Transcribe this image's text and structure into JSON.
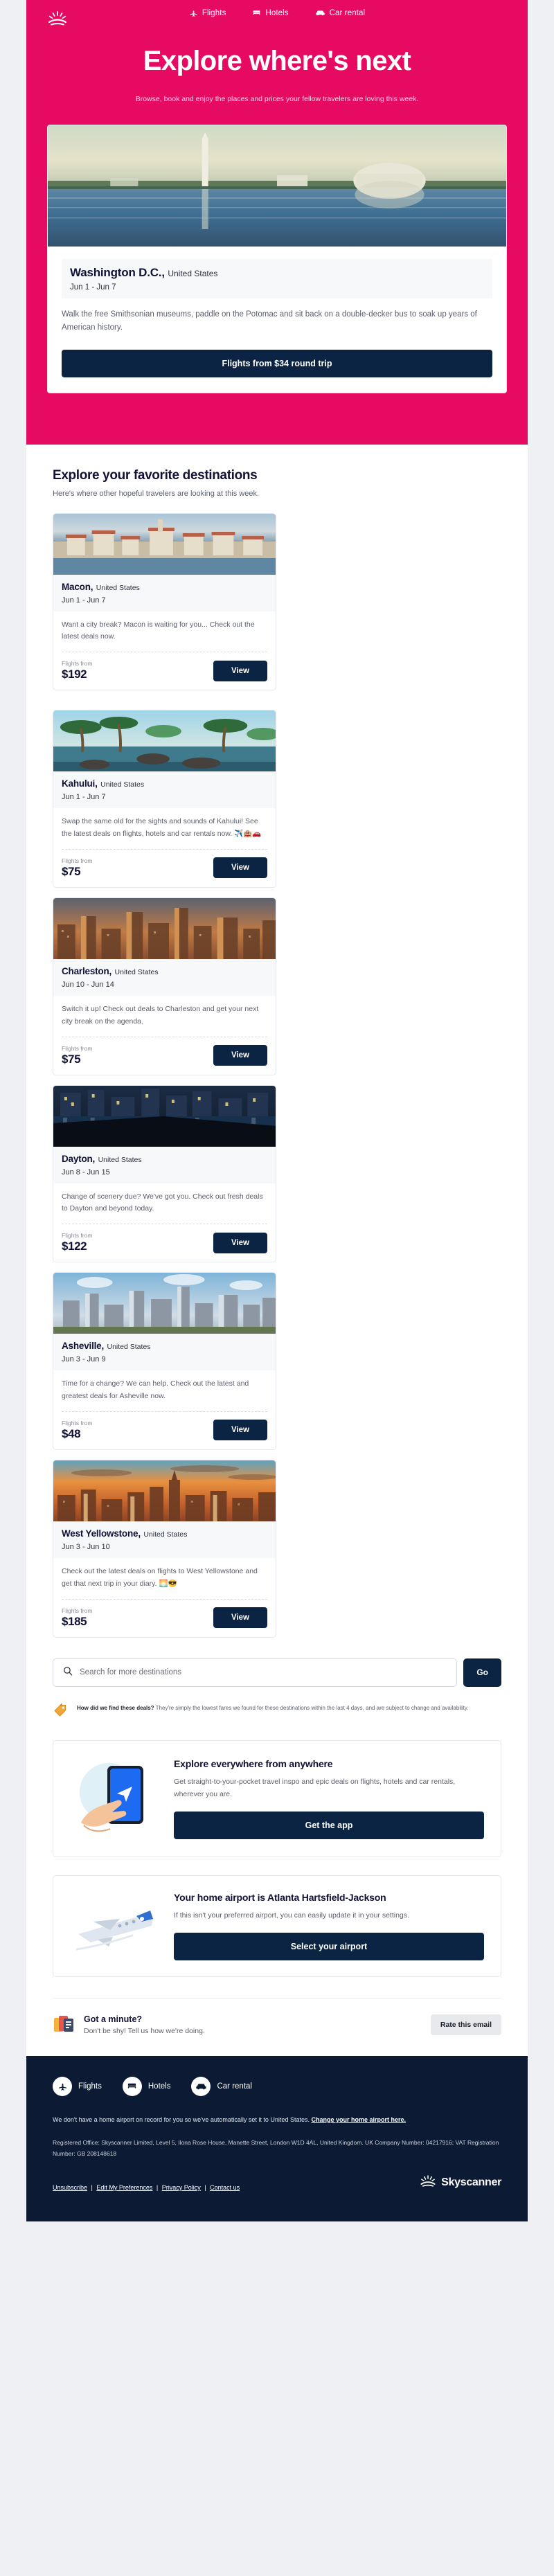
{
  "brand": {
    "name": "Skyscanner",
    "pink": "#e70a62",
    "navy": "#0c2444",
    "footer_navy": "#0c1b33"
  },
  "nav": {
    "logo": "sunrise-logo",
    "links": [
      {
        "label": "Flights",
        "icon": "plane-icon"
      },
      {
        "label": "Hotels",
        "icon": "bed-icon"
      },
      {
        "label": "Car rental",
        "icon": "car-icon"
      }
    ]
  },
  "hero": {
    "title": "Explore where's next",
    "subtitle": "Browse, book and enjoy the places and prices your fellow travelers are loving this week."
  },
  "feature": {
    "photo": "washington-dc-tidal-basin-photo",
    "name": "Washington D.C.,",
    "country": "United States",
    "dates": "Jun 1 - Jun 7",
    "description": "Walk the free Smithsonian museums, paddle on the Potomac and sit back on a double-decker bus to soak up years of American history.",
    "cta": "Flights from $34 round trip"
  },
  "section": {
    "title": "Explore your favorite destinations",
    "subtitle": "Here's where other hopeful travelers are looking at this week."
  },
  "destinations": [
    {
      "photo": "macon-coastal-town-photo",
      "name": "Macon,",
      "country": "United States",
      "dates": "Jun 1 - Jun 7",
      "description": "Want a city break? Macon is waiting for you... Check out the latest deals now.",
      "price_label": "Flights from",
      "price": "$192",
      "cta": "View"
    },
    {
      "photo": "kahului-palm-beach-photo",
      "name": "Kahului,",
      "country": "United States",
      "dates": "Jun 1 - Jun 7",
      "description": "Swap the same old for the sights and sounds of Kahului! See the latest deals on flights, hotels and car rentals now. ✈️🏨🚗",
      "price_label": "Flights from",
      "price": "$75",
      "cta": "View"
    },
    {
      "photo": "charleston-sunset-skyline-photo",
      "name": "Charleston,",
      "country": "United States",
      "dates": "Jun 10 - Jun 14",
      "description": "Switch it up! Check out deals to Charleston and get your next city break on the agenda.",
      "price_label": "Flights from",
      "price": "$75",
      "cta": "View"
    },
    {
      "photo": "dayton-night-waterfront-photo",
      "name": "Dayton,",
      "country": "United States",
      "dates": "Jun 8 - Jun 15",
      "description": "Change of scenery due? We've got you. Check out fresh deals to Dayton and beyond today.",
      "price_label": "Flights from",
      "price": "$122",
      "cta": "View"
    },
    {
      "photo": "asheville-city-skyline-photo",
      "name": "Asheville,",
      "country": "United States",
      "dates": "Jun 3 - Jun 9",
      "description": "Time for a change? We can help. Check out the latest and greatest deals for Asheville now.",
      "price_label": "Flights from",
      "price": "$48",
      "cta": "View"
    },
    {
      "photo": "west-yellowstone-sunset-skyline-photo",
      "name": "West Yellowstone,",
      "country": "United States",
      "dates": "Jun 3 - Jun 10",
      "description": "Check out the latest deals on flights to West Yellowstone and get that next trip in your diary. 🌅😎",
      "price_label": "Flights from",
      "price": "$185",
      "cta": "View"
    }
  ],
  "search": {
    "placeholder": "Search for more destinations",
    "value": "",
    "button": "Go",
    "icon": "search-icon"
  },
  "disclaimer": {
    "icon": "price-tag-icon",
    "lead": "How did we find these deals?",
    "text": " They're simply the lowest fares we found for these destinations within the last 4 days, and are subject to change and availability."
  },
  "promos": [
    {
      "art": "hand-holding-phone-illustration",
      "title": "Explore everywhere from anywhere",
      "description": "Get straight-to-your-pocket travel inspo and epic deals on flights, hotels and car rentals, wherever you are.",
      "cta": "Get the app"
    },
    {
      "art": "airplane-illustration",
      "title": "Your home airport is Atlanta Hartsfield-Jackson",
      "description": "If this isn't your preferred airport, you can easily update it in your settings.",
      "cta": "Select your airport"
    }
  ],
  "feedback": {
    "icon": "feedback-cards-icon",
    "title": "Got a minute?",
    "subtitle": "Don't be shy! Tell us how we're doing.",
    "button": "Rate this email"
  },
  "footer": {
    "links": [
      {
        "label": "Flights",
        "icon": "plane-icon"
      },
      {
        "label": "Hotels",
        "icon": "bed-icon"
      },
      {
        "label": "Car rental",
        "icon": "car-icon"
      }
    ],
    "home_airport_note": "We don't have a home airport on record for you so we've automatically set it to United States. ",
    "home_airport_link": "Change your home airport here.",
    "legal": "Registered Office: Skyscanner Limited, Level 5, Ilona Rose House, Manette Street, London W1D 4AL, United Kingdom. UK Company Number: 04217916; VAT Registration Number: GB 208148618",
    "bottom_links": [
      "Unsubscribe",
      "Edit My Preferences",
      "Privacy Policy",
      "Contact us"
    ],
    "brand_name": "Skyscanner"
  }
}
